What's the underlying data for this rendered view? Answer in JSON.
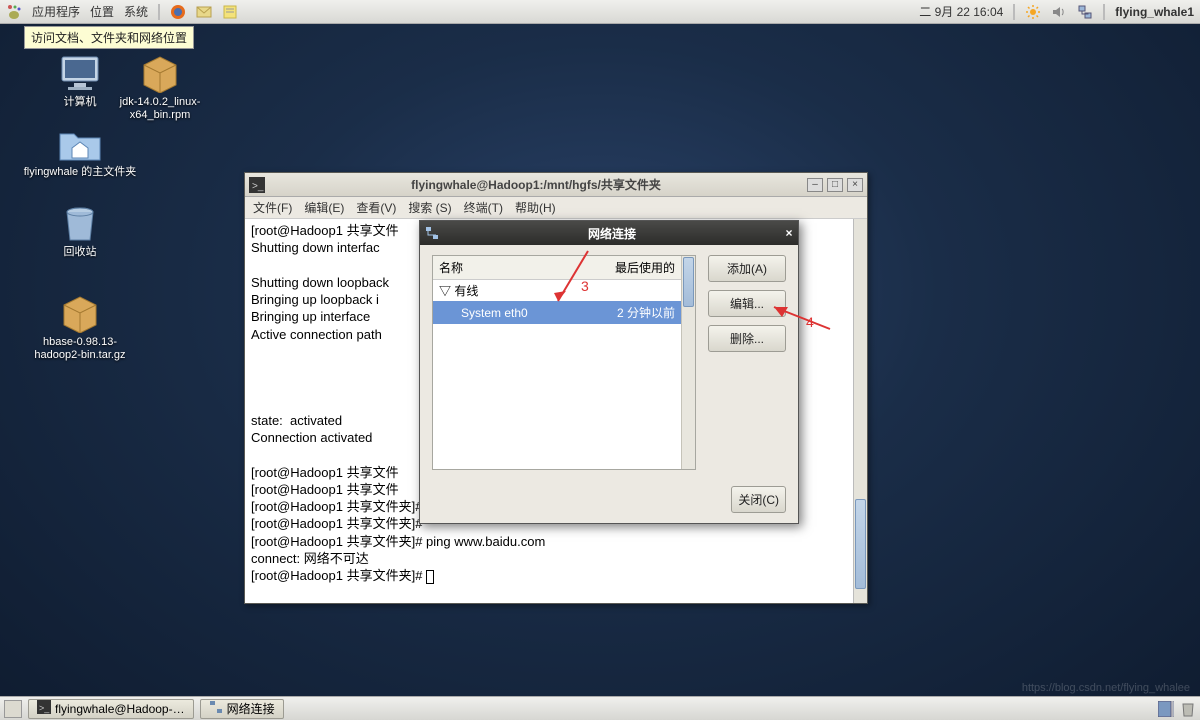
{
  "panel": {
    "menus": [
      "应用程序",
      "位置",
      "系统"
    ],
    "tooltip": "访问文档、文件夹和网络位置",
    "clock": "二 9月 22 16:04",
    "user": "flying_whale1"
  },
  "desktop_icons": {
    "computer": "计算机",
    "jdk": "jdk-14.0.2_linux-x64_bin.rpm",
    "home": "flyingwhale 的主文件夹",
    "trash": "回收站",
    "hbase": "hbase-0.98.13-hadoop2-bin.tar.gz"
  },
  "terminal": {
    "title": "flyingwhale@Hadoop1:/mnt/hgfs/共享文件夹",
    "menus": [
      "文件(F)",
      "编辑(E)",
      "查看(V)",
      "搜索 (S)",
      "终端(T)",
      "帮助(H)"
    ],
    "text": "[root@Hadoop1 共享文件\nShutting down interfac\n\nShutting down loopback\nBringing up loopback i\nBringing up interface \nActive connection path                                               /2\n\n\n\n\nstate:  activated\nConnection activated\n\n[root@Hadoop1 共享文件\n[root@Hadoop1 共享文件\n[root@Hadoop1 共享文件夹]#\n[root@Hadoop1 共享文件夹]#\n[root@Hadoop1 共享文件夹]# ping www.baidu.com\nconnect: 网络不可达\n[root@Hadoop1 共享文件夹]# "
  },
  "netdlg": {
    "title": "网络连接",
    "col_name": "名称",
    "col_last": "最后使用的",
    "cat_wired": "有线",
    "item_name": "System eth0",
    "item_last": "2 分钟以前",
    "btn_add": "添加(A)",
    "btn_edit": "编辑...",
    "btn_del": "删除...",
    "btn_close": "关闭(C)"
  },
  "annotations": {
    "label3": "3",
    "label4": "4"
  },
  "taskbar": {
    "task1": "flyingwhale@Hadoop-…",
    "task2": "网络连接"
  },
  "watermark": "https://blog.csdn.net/flying_whalee"
}
